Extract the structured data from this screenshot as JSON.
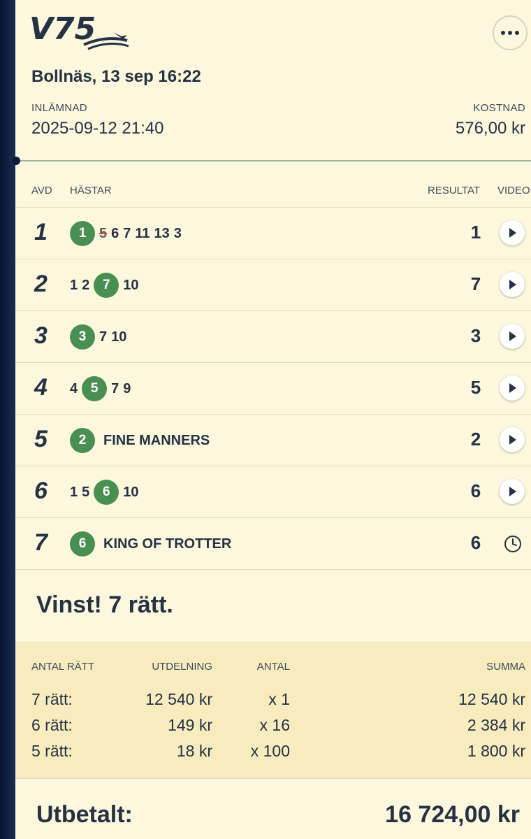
{
  "ticket": {
    "race": "Bollnäs, 13 sep 16:22",
    "submitted_label": "INLÄMNAD",
    "submitted_value": "2025-09-12 21:40",
    "cost_label": "KOSTNAD",
    "cost_value": "576,00 kr"
  },
  "brand": {
    "accent": "#4a8f52",
    "text": "#243244",
    "background": "#fdf7dd"
  },
  "table": {
    "headers": {
      "avd": "AVD",
      "horses": "HÄSTAR",
      "result": "RESULTAT",
      "video": "VIDEO"
    },
    "rows": [
      {
        "avd": "1",
        "picks": [
          {
            "n": "1",
            "win": true
          },
          {
            "n": "5",
            "scratched": true
          },
          {
            "n": "6"
          },
          {
            "n": "7"
          },
          {
            "n": "11"
          },
          {
            "n": "13"
          },
          {
            "n": "3"
          }
        ],
        "name": "",
        "result": "1",
        "video": "play-icon"
      },
      {
        "avd": "2",
        "picks": [
          {
            "n": "1"
          },
          {
            "n": "2"
          },
          {
            "n": "7",
            "win": true
          },
          {
            "n": "10"
          }
        ],
        "name": "",
        "result": "7",
        "video": "play-icon"
      },
      {
        "avd": "3",
        "picks": [
          {
            "n": "3",
            "win": true
          },
          {
            "n": "7"
          },
          {
            "n": "10"
          }
        ],
        "name": "",
        "result": "3",
        "video": "play-icon"
      },
      {
        "avd": "4",
        "picks": [
          {
            "n": "4"
          },
          {
            "n": "5",
            "win": true
          },
          {
            "n": "7"
          },
          {
            "n": "9"
          }
        ],
        "name": "",
        "result": "5",
        "video": "play-icon"
      },
      {
        "avd": "5",
        "picks": [
          {
            "n": "2",
            "win": true
          }
        ],
        "name": "FINE MANNERS",
        "result": "2",
        "video": "play-icon"
      },
      {
        "avd": "6",
        "picks": [
          {
            "n": "1"
          },
          {
            "n": "5"
          },
          {
            "n": "6",
            "win": true
          },
          {
            "n": "10"
          }
        ],
        "name": "",
        "result": "6",
        "video": "play-icon"
      },
      {
        "avd": "7",
        "picks": [
          {
            "n": "6",
            "win": true
          }
        ],
        "name": "KING OF TROTTER",
        "result": "6",
        "video": "clock-icon"
      }
    ]
  },
  "win_message": "Vinst! 7 rätt.",
  "payout": {
    "headers": {
      "antal_ratt": "ANTAL RÄTT",
      "utdelning": "UTDELNING",
      "antal": "ANTAL",
      "summa": "SUMMA"
    },
    "rows": [
      {
        "antal_ratt": "7 rätt:",
        "utdelning": "12 540 kr",
        "antal": "x 1",
        "summa": "12 540 kr"
      },
      {
        "antal_ratt": "6 rätt:",
        "utdelning": "149 kr",
        "antal": "x 16",
        "summa": "2 384 kr"
      },
      {
        "antal_ratt": "5 rätt:",
        "utdelning": "18 kr",
        "antal": "x 100",
        "summa": "1 800 kr"
      }
    ]
  },
  "total": {
    "label": "Utbetalt:",
    "value": "16 724,00 kr"
  }
}
